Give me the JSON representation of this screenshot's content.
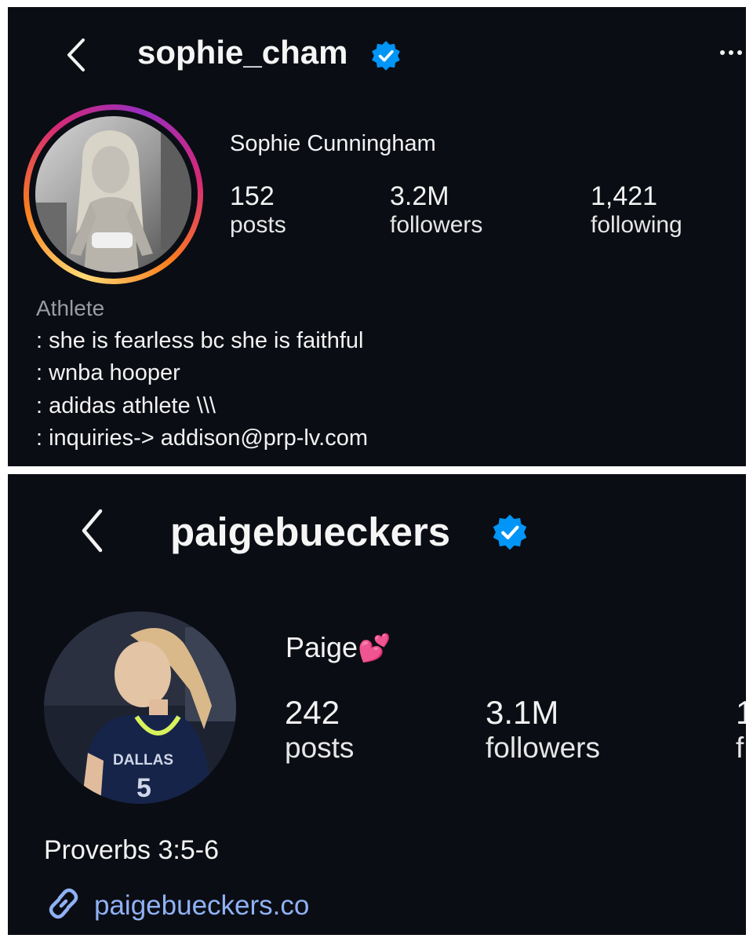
{
  "profiles": [
    {
      "username": "sophie_cham",
      "display_name": "Sophie Cunningham",
      "stats": {
        "posts_count": "152",
        "posts_label": "posts",
        "followers_count": "3.2M",
        "followers_label": "followers",
        "following_count": "1,421",
        "following_label": "following"
      },
      "category": "Athlete",
      "bio": [
        ": she is fearless bc she is faithful",
        ": wnba hooper",
        ": adidas athlete \\\\\\",
        ": inquiries-> addison@prp-lv.com"
      ],
      "icons": [
        "back-chevron-icon",
        "verified-badge-icon",
        "more-options-icon"
      ]
    },
    {
      "username": "paigebueckers",
      "display_name": "Paige",
      "display_name_emoji": "💕",
      "stats": {
        "posts_count": "242",
        "posts_label": "posts",
        "followers_count": "3.1M",
        "followers_label": "followers",
        "following_count_partial": "1",
        "following_label_partial": "f"
      },
      "bio": [
        "Proverbs 3:5-6"
      ],
      "link": "paigebueckers.co",
      "jersey_text": "DALLAS",
      "jersey_number": "5",
      "icons": [
        "back-chevron-icon",
        "verified-badge-icon",
        "link-icon"
      ]
    }
  ],
  "colors": {
    "background": "#0b0d14",
    "text": "#f2f2f2",
    "muted": "#9a9ca3",
    "verified_blue": "#0095f6",
    "link_blue": "#8fb2f5",
    "story_ring": [
      "#feda75",
      "#fa7e1e",
      "#d62976",
      "#962fbf"
    ]
  }
}
